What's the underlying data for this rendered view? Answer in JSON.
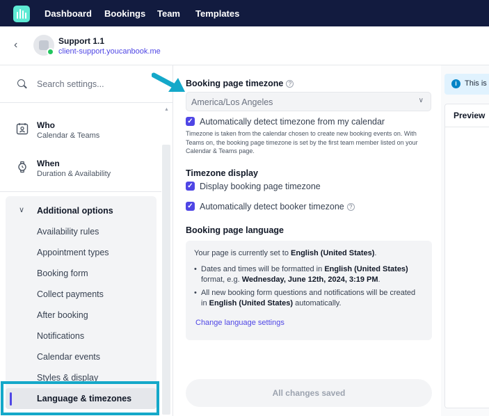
{
  "topbar": {
    "logo_icon": "calendar-bars-icon",
    "nav": [
      "Dashboard",
      "Bookings",
      "Team",
      "Templates"
    ]
  },
  "account": {
    "name": "Support 1.1",
    "url": "client-support.youcanbook.me",
    "status_color": "#22c55e"
  },
  "sidebar": {
    "search_placeholder": "Search settings...",
    "sections": [
      {
        "title": "Who",
        "subtitle": "Calendar & Teams",
        "icon": "calendar-user-icon"
      },
      {
        "title": "When",
        "subtitle": "Duration & Availability",
        "icon": "watch-icon"
      }
    ],
    "additional": {
      "title": "Additional options",
      "items": [
        "Availability rules",
        "Appointment types",
        "Booking form",
        "Collect payments",
        "After booking",
        "Notifications",
        "Calendar events",
        "Styles & display"
      ],
      "active": "Language & timezones"
    }
  },
  "main": {
    "timezone_label": "Booking page timezone",
    "timezone_value": "America/Los Angeles",
    "auto_detect_label": "Automatically detect timezone from my calendar",
    "auto_detect_hint": "Timezone is taken from the calendar chosen to create new booking events on. With Teams on, the booking page timezone is set by the first team member listed on your Calendar & Teams page.",
    "display_heading": "Timezone display",
    "display_tz_label": "Display booking page timezone",
    "auto_booker_label": "Automatically detect booker timezone",
    "language_heading": "Booking page language",
    "language": {
      "intro": "Your page is currently set to",
      "lang": "English (United States)",
      "b1_pre": "Dates and times will be formatted in",
      "b1_lang": "English (United States)",
      "b1_mid": "format, e.g.",
      "b1_example": "Wednesday, June 12th, 2024, 3:19 PM",
      "b2_pre": "All new booking form questions and notifications will be created in",
      "b2_lang": "English (United States)",
      "b2_post": "automatically.",
      "link": "Change language settings"
    },
    "save_label": "All changes saved"
  },
  "right": {
    "info_text": "This is o",
    "preview_tab": "Preview"
  },
  "colors": {
    "topbar": "#121b3f",
    "accent": "#4f46e5",
    "highlight": "#14a8c9"
  }
}
